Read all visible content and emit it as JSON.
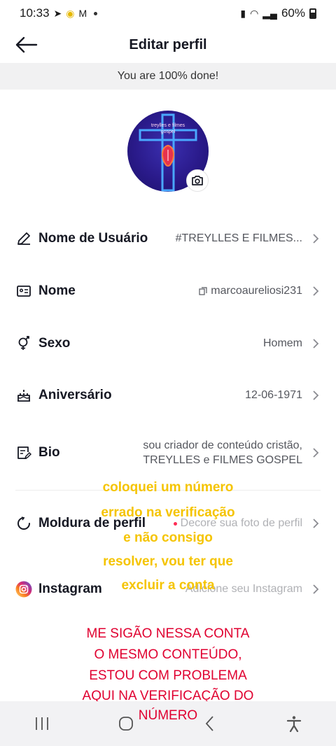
{
  "status": {
    "time": "10:33",
    "battery": "60%"
  },
  "header": {
    "title": "Editar perfil"
  },
  "banner": {
    "text": "You are 100% done!"
  },
  "avatar": {
    "overlay_text_1": "treylles e filmes",
    "overlay_text_2": "gospel"
  },
  "rows": [
    {
      "label": "Nome de Usuário",
      "value": "#TREYLLES E FILMES..."
    },
    {
      "label": "Nome",
      "value": "marcoaureliosi231"
    },
    {
      "label": "Sexo",
      "value": "Homem"
    },
    {
      "label": "Aniversário",
      "value": "12-06-1971"
    },
    {
      "label": "Bio",
      "value_line1": "sou criador de conteúdo cristão,",
      "value_line2": "TREYLLES e FILMES GOSPEL"
    },
    {
      "label": "Moldura de perfil",
      "value": "Decore sua foto de perfil"
    },
    {
      "label": "Instagram",
      "value": "Adicione seu Instagram"
    }
  ],
  "overlay_yellow": [
    "coloquei um número",
    "errado  na verificação",
    "e não  consigo",
    "resolver,  vou ter que",
    "excluir a conta"
  ],
  "overlay_red": [
    "ME SIGÃO NESSA CONTA",
    "O MESMO CONTEÚDO,",
    "ESTOU COM PROBLEMA",
    "AQUI NA VERIFICAÇÃO DO",
    "NÚMERO"
  ],
  "colors": {
    "accent_red": "#fe2c55",
    "overlay_yellow": "#f5c400",
    "overlay_red": "#e00030"
  }
}
